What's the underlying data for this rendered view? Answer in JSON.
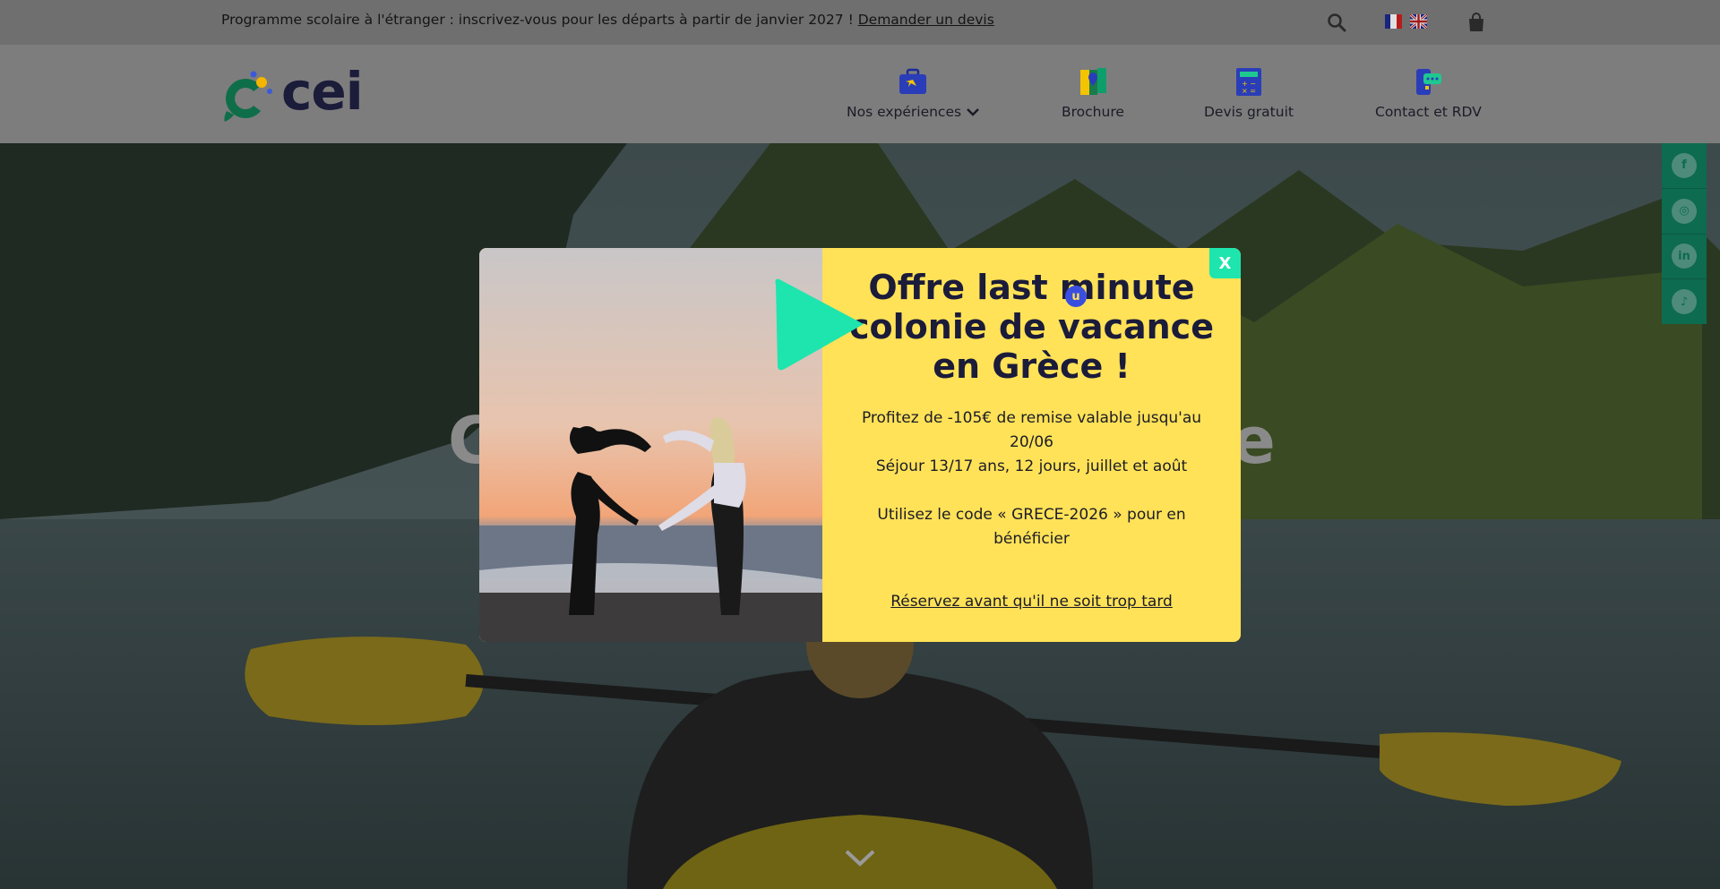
{
  "topbar": {
    "announcement": "Programme scolaire à l'étranger : inscrivez-vous pour les départs à partir de janvier 2027 !",
    "announcement_link": "Demander un devis",
    "icons": [
      "search-icon",
      "flag-fr-icon",
      "flag-gb-icon",
      "bag-icon"
    ]
  },
  "header": {
    "logo_text": "cei",
    "nav": [
      {
        "label": "Nos expériences",
        "icon": "suitcase-icon"
      },
      {
        "label": "Brochure",
        "icon": "map-pin-icon"
      },
      {
        "label": "Devis gratuit",
        "icon": "calculator-icon"
      },
      {
        "label": "Contact et RDV",
        "icon": "phone-chat-icon"
      }
    ]
  },
  "social": {
    "items": [
      {
        "name": "facebook",
        "glyph": "f"
      },
      {
        "name": "instagram",
        "glyph": "◎"
      },
      {
        "name": "linkedin",
        "glyph": "in"
      },
      {
        "name": "tiktok",
        "glyph": "♪"
      }
    ]
  },
  "modal": {
    "title": "Offre last minute colonie de vacance en Grèce !",
    "line1": "Profitez de -105€ de remise valable jusqu'au 20/06",
    "line2": "Séjour 13/17 ans, 12 jours, juillet et août",
    "line3": "Utilisez le code « GRECE-2026 » pour en bénéficier",
    "cta": "Réservez avant qu'il ne soit trop tard",
    "close_label": "X"
  },
  "colors": {
    "modal_bg": "#ffe257",
    "accent_green": "#1ee5ad",
    "brand_navy": "#1b1b3a"
  }
}
